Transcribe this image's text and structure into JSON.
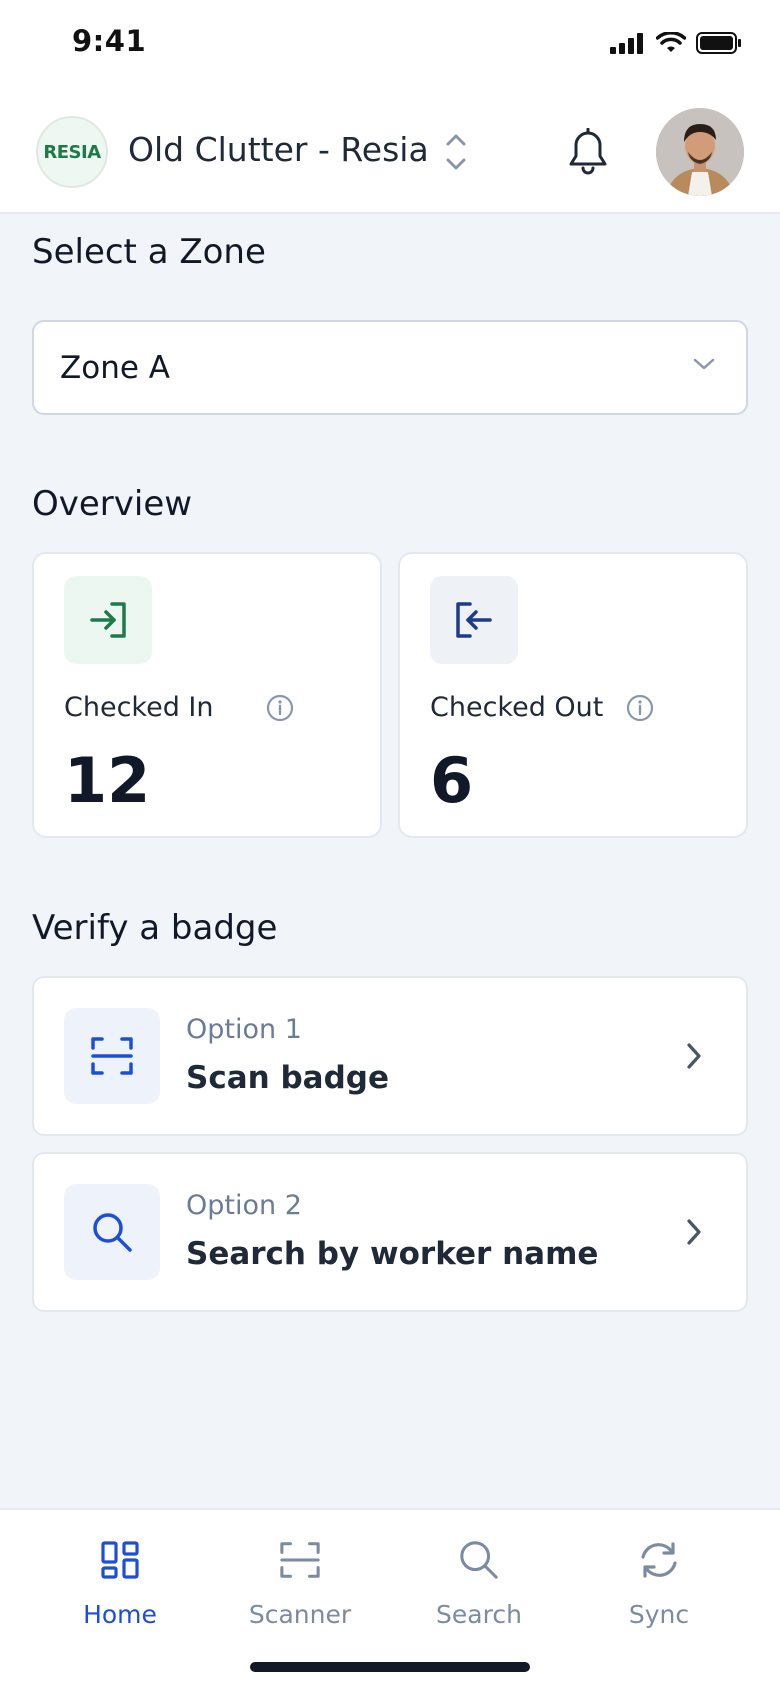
{
  "status_bar": {
    "time": "9:41"
  },
  "header": {
    "org_logo_text": "RESIA",
    "org_name": "Old Clutter - Resia"
  },
  "zone": {
    "title": "Select a Zone",
    "selected": "Zone A"
  },
  "overview": {
    "title": "Overview",
    "cards": [
      {
        "label": "Checked In",
        "value": "12",
        "accent": "#1f7a4a",
        "icon_bg": "#edf7f1",
        "icon": "check-in-icon"
      },
      {
        "label": "Checked Out",
        "value": "6",
        "accent": "#1e3a8a",
        "icon_bg": "#eef2f7",
        "icon": "check-out-icon"
      }
    ]
  },
  "verify": {
    "title": "Verify a badge",
    "options": [
      {
        "label": "Option 1",
        "title": "Scan badge",
        "icon": "scan-icon"
      },
      {
        "label": "Option 2",
        "title": "Search by worker name",
        "icon": "search-icon"
      }
    ]
  },
  "tabs": [
    {
      "label": "Home",
      "icon": "home-icon",
      "active": true
    },
    {
      "label": "Scanner",
      "icon": "scanner-icon",
      "active": false
    },
    {
      "label": "Search",
      "icon": "search-icon",
      "active": false
    },
    {
      "label": "Sync",
      "icon": "sync-icon",
      "active": false
    }
  ],
  "colors": {
    "primary": "#1d4ed8",
    "background": "#f1f4f9",
    "muted": "#7d8ba0"
  }
}
